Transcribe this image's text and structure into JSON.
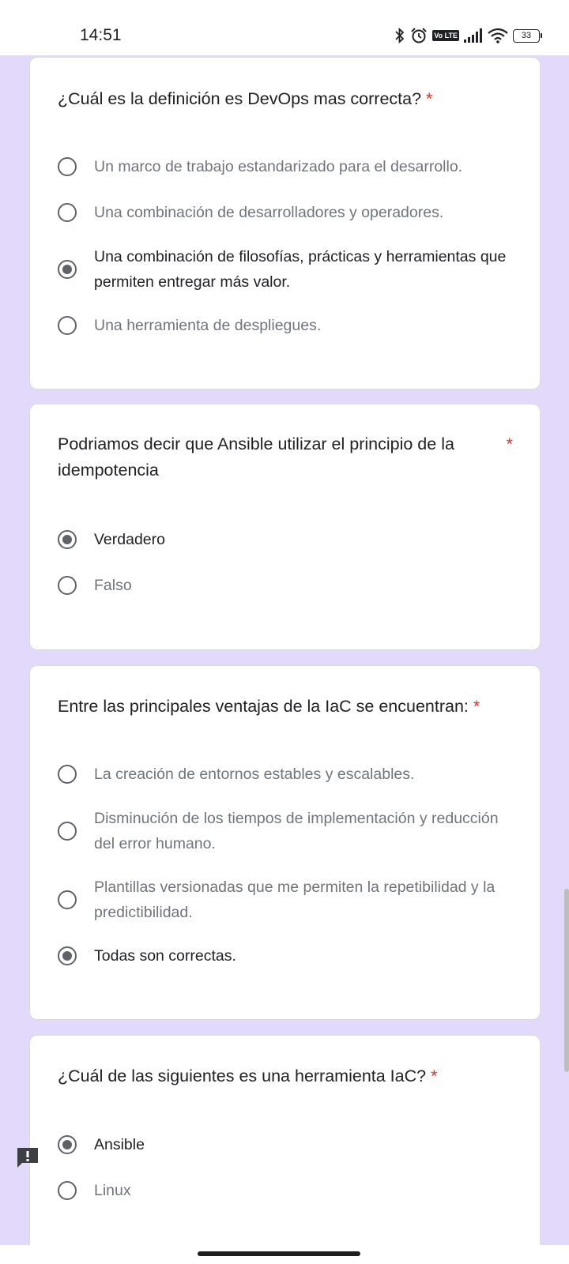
{
  "status_bar": {
    "time": "14:51",
    "volte": "Vo LTE",
    "battery": "33"
  },
  "questions": [
    {
      "text": "¿Cuál es la definición es DevOps mas correcta?",
      "required": "*",
      "options": [
        {
          "label": "Un marco de trabajo estandarizado para el desarrollo.",
          "selected": false
        },
        {
          "label": "Una combinación de desarrolladores y operadores.",
          "selected": false
        },
        {
          "label": "Una combinación de filosofías, prácticas y herramientas que permiten entregar más valor.",
          "selected": true
        },
        {
          "label": "Una herramienta de despliegues.",
          "selected": false
        }
      ]
    },
    {
      "text": "Podriamos decir que Ansible utilizar el principio de la idempotencia",
      "required": "*",
      "options": [
        {
          "label": "Verdadero",
          "selected": true
        },
        {
          "label": "Falso",
          "selected": false
        }
      ]
    },
    {
      "text": "Entre las principales ventajas de la IaC se encuentran:",
      "required": "*",
      "options": [
        {
          "label": "La creación de entornos estables y escalables.",
          "selected": false
        },
        {
          "label": "Disminución de los tiempos de implementación y reducción del error humano.",
          "selected": false
        },
        {
          "label": "Plantillas versionadas que me permiten la repetibilidad y la predictibilidad.",
          "selected": false
        },
        {
          "label": "Todas son correctas.",
          "selected": true
        }
      ]
    },
    {
      "text": "¿Cuál de las siguientes es una herramienta IaC?",
      "required": "*",
      "options": [
        {
          "label": "Ansible",
          "selected": true
        },
        {
          "label": "Linux",
          "selected": false
        }
      ]
    }
  ],
  "colors": {
    "background": "#e2d9fb",
    "required_star": "#d93025",
    "radio": "#5f6368"
  },
  "icons": [
    "bluetooth-icon",
    "alarm-icon",
    "volte-icon",
    "signal-icon",
    "wifi-icon",
    "battery-icon",
    "feedback-icon"
  ]
}
